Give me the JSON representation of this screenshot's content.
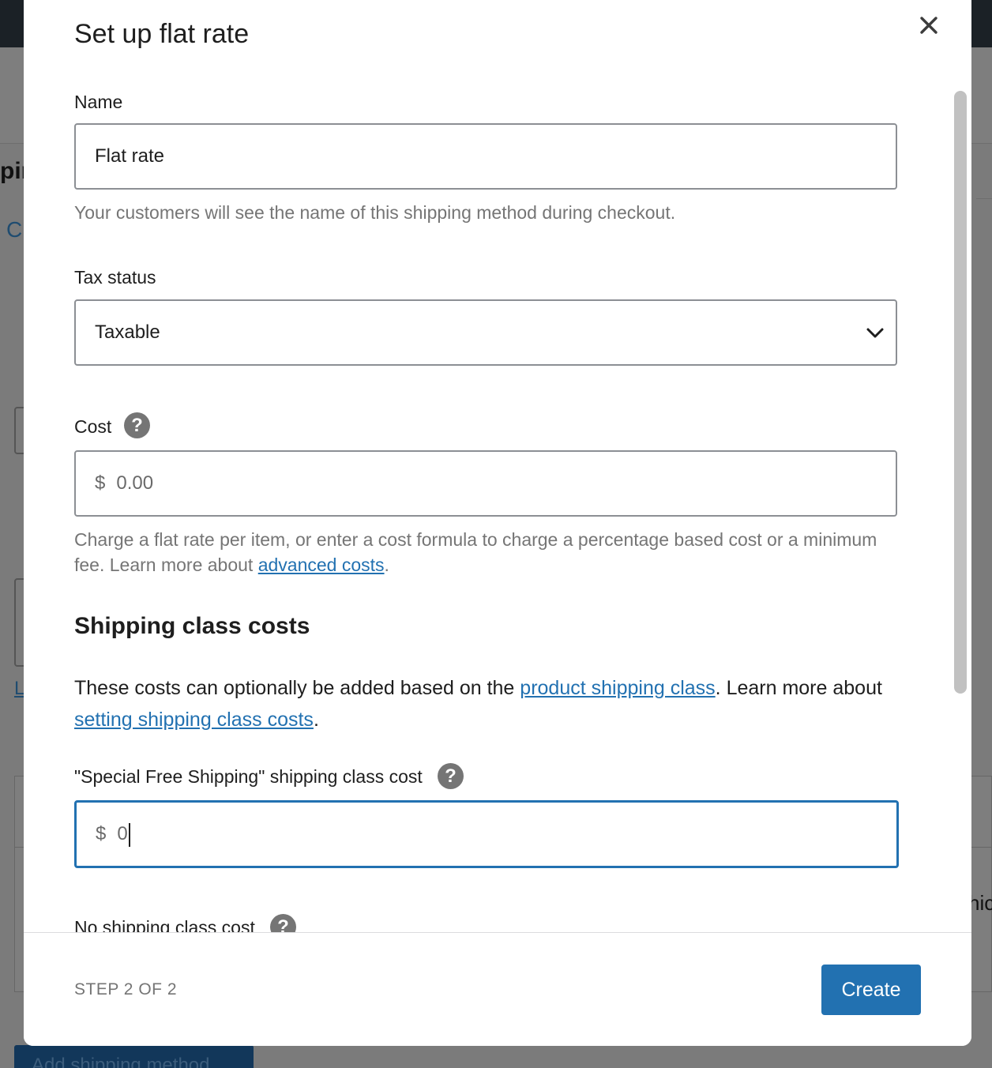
{
  "background": {
    "partial_heading": "pin",
    "partial_link": "Cl",
    "partial_link_2": "L",
    "partial_right_text": "hic",
    "add_method_button": "Add shipping method"
  },
  "modal": {
    "title": "Set up flat rate",
    "name": {
      "label": "Name",
      "value": "Flat rate",
      "help": "Your customers will see the name of this shipping method during checkout."
    },
    "tax_status": {
      "label": "Tax status",
      "selected": "Taxable"
    },
    "cost": {
      "label": "Cost",
      "prefix": "$",
      "placeholder": "0.00",
      "help_before": "Charge a flat rate per item, or enter a cost formula to charge a percentage based cost or a minimum fee. Learn more about ",
      "help_link": "advanced costs",
      "help_after": "."
    },
    "shipping_class_section": {
      "title": "Shipping class costs",
      "text_before": "These costs can optionally be added based on the ",
      "link_1": "product shipping class",
      "text_middle": ". Learn more about ",
      "link_2": "setting shipping class costs",
      "text_after": "."
    },
    "special_free_shipping": {
      "label": "\"Special Free Shipping\" shipping class cost",
      "prefix": "$",
      "value": "0"
    },
    "no_shipping_class": {
      "label": "No shipping class cost"
    },
    "footer": {
      "step": "STEP 2 OF 2",
      "create": "Create"
    },
    "icons": {
      "close": "close-icon",
      "help": "question-circle-icon",
      "chevron": "chevron-down-icon"
    },
    "colors": {
      "accent": "#2271b1",
      "overlay": "#7b7b7b"
    }
  }
}
